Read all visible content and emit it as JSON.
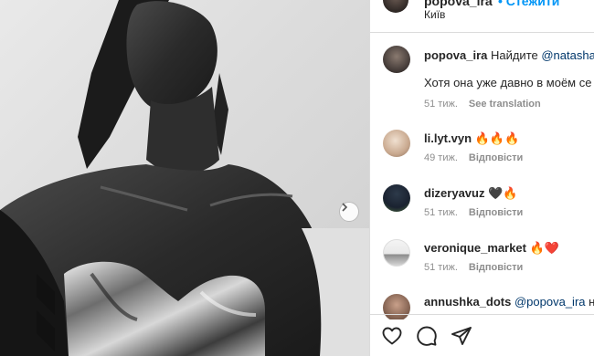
{
  "post": {
    "author": "popova_ira",
    "follow_label": "• Стежити",
    "location": "Київ"
  },
  "comments": [
    {
      "user": "popova_ira",
      "text": " Найдите ",
      "mention": "@natasha",
      "text2": "Хотя она уже давно в моём се",
      "time": "51 тиж.",
      "action": "See translation"
    },
    {
      "user": "li.lyt.vyn",
      "text": " 🔥🔥🔥",
      "time": "49 тиж.",
      "action": "Відповісти"
    },
    {
      "user": "dizeryavuz",
      "text": " 🖤🔥",
      "time": "51 тиж.",
      "action": "Відповісти"
    },
    {
      "user": "veronique_market",
      "text": " 🔥❤️",
      "time": "51 тиж.",
      "action": "Відповісти"
    },
    {
      "user": "annushka_dots",
      "text": " ",
      "mention": "@popova_ira",
      "text_after": " н"
    }
  ],
  "icons": {
    "like": "heart-icon",
    "comment": "comment-icon",
    "share": "share-icon",
    "next": "chevron-right-icon"
  },
  "colors": {
    "link": "#0095f6",
    "mention": "#00376b",
    "meta": "#8e8e8e",
    "divider": "#dbdbdb"
  }
}
